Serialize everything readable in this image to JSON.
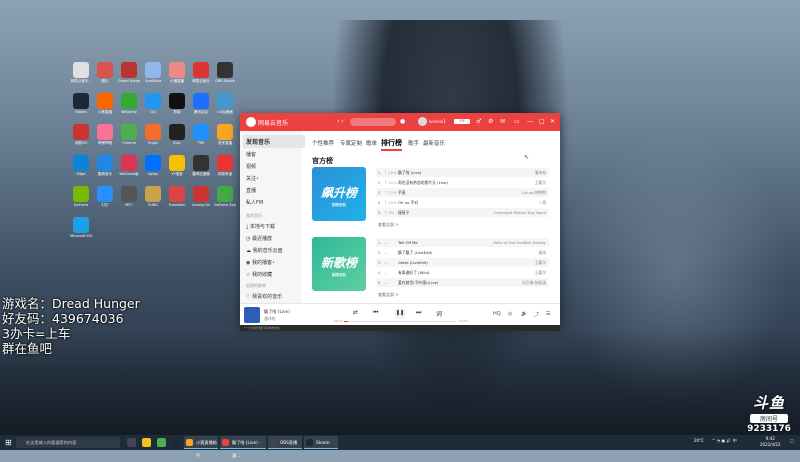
{
  "overlay": {
    "lines": [
      "游戏名：Dread Hunger",
      "好友码：439674036",
      "3办卡=上车",
      "群在鱼吧"
    ]
  },
  "douyu": {
    "logo": "斗鱼",
    "room_label": "房间号",
    "room_number": "9233176"
  },
  "desktop_icons": [
    {
      "label": "网易云音乐...",
      "color": "#e0e0e0"
    },
    {
      "label": "图片",
      "color": "#d9534f"
    },
    {
      "label": "Dread Hunger",
      "color": "#b33"
    },
    {
      "label": "OneDrive",
      "color": "#8fb7e8"
    },
    {
      "label": "小猪直播",
      "color": "#e88"
    },
    {
      "label": "网易云音乐",
      "color": "#d33"
    },
    {
      "label": "OBS Studio",
      "color": "#333"
    },
    {
      "label": "Steam",
      "color": "#1b2838"
    },
    {
      "label": "斗鱼直播",
      "color": "#f60"
    },
    {
      "label": "WeGame",
      "color": "#3a3"
    },
    {
      "label": "QQ",
      "color": "#2196f3"
    },
    {
      "label": "剪映",
      "color": "#111"
    },
    {
      "label": "腾讯会议",
      "color": "#1e6fff"
    },
    {
      "label": "UU加速器",
      "color": "#49c"
    },
    {
      "label": "网易UU",
      "color": "#c33"
    },
    {
      "label": "哔哩哔哩",
      "color": "#fb7299"
    },
    {
      "label": "Chrome",
      "color": "#4caf50"
    },
    {
      "label": "Origin",
      "color": "#f56c2d"
    },
    {
      "label": "Epic",
      "color": "#222"
    },
    {
      "label": "TIM",
      "color": "#1e90ff"
    },
    {
      "label": "虎牙直播",
      "color": "#f5a623"
    },
    {
      "label": "Edge",
      "color": "#0b84d8"
    },
    {
      "label": "酷狗音乐",
      "color": "#2086e8"
    },
    {
      "label": "WeGame版",
      "color": "#d35"
    },
    {
      "label": "Uplay",
      "color": "#0070ff"
    },
    {
      "label": "YY语音",
      "color": "#f5c200"
    },
    {
      "label": "雷神加速器",
      "color": "#333"
    },
    {
      "label": "网易有道",
      "color": "#e33"
    },
    {
      "label": "GeForce",
      "color": "#76b900"
    },
    {
      "label": "钉钉",
      "color": "#2a8eff"
    },
    {
      "label": "MFC",
      "color": "#555"
    },
    {
      "label": "PUBG",
      "color": "#c9a24a"
    },
    {
      "label": "Yuanshen",
      "color": "#d44"
    },
    {
      "label": "Among Us",
      "color": "#c33"
    },
    {
      "label": "GeForce Experience",
      "color": "#4a4"
    },
    {
      "label": "Microsoft Edge",
      "color": "#1da1e3"
    }
  ],
  "music_window": {
    "app_name": "网易云音乐",
    "username": "lvxinlin1",
    "vip": "VIP",
    "sidebar": {
      "items": [
        {
          "label": "发现音乐",
          "active": true
        },
        {
          "label": "播客"
        },
        {
          "label": "视频"
        },
        {
          "label": "关注",
          "dot": true
        },
        {
          "label": "直播"
        },
        {
          "label": "私人FM"
        }
      ],
      "section": "我的音乐",
      "my_items": [
        {
          "label": "本地与下载"
        },
        {
          "label": "最近播放"
        },
        {
          "label": "我的音乐云盘"
        },
        {
          "label": "我的播客",
          "dot": true
        },
        {
          "label": "我的收藏"
        }
      ],
      "created": "创建的歌单",
      "created_item": "我喜欢的音乐"
    },
    "tabs": [
      "个性推荐",
      "专属定制",
      "歌单",
      "排行榜",
      "歌手",
      "最新音乐"
    ],
    "active_tab": "排行榜",
    "section_title": "官方榜",
    "charts": [
      {
        "title": "飙升榜",
        "subtitle": "刚刚更新",
        "songs": [
          {
            "rank": "1",
            "tag": "↑ 16%",
            "name": "飘了啦 (Live)",
            "artist": "潘玮柏"
          },
          {
            "rank": "2",
            "tag": "↑ 12%",
            "name": "再也没有热恋的那片天 (Live)",
            "artist": "王嘉尔"
          },
          {
            "rank": "3",
            "tag": "↑ 11%",
            "name": "手表",
            "artist": "Lirium/何鸭鸭"
          },
          {
            "rank": "4",
            "tag": "↑ 10%",
            "name": "Oh no 不对",
            "artist": "二胡"
          },
          {
            "rank": "5",
            "tag": "↑ 9%",
            "name": "接接子",
            "artist": "Overnight Mutual Boy Band"
          }
        ],
        "see_all": "查看全部 >"
      },
      {
        "title": "新歌榜",
        "subtitle": "刚刚更新",
        "songs": [
          {
            "rank": "1",
            "tag": "—",
            "name": "Tell Off Me",
            "artist": "Hollo of the Goldfish Bloody"
          },
          {
            "rank": "2",
            "tag": "—",
            "name": "飘了飘了 (LiveEdit)",
            "artist": "潘玮"
          },
          {
            "rank": "3",
            "tag": "—",
            "name": "Gotta (LiveEdit)",
            "artist": "王嘉尔"
          },
          {
            "rank": "4",
            "tag": "—",
            "name": "有离谱好了 (Wild)",
            "artist": "王嘉尔"
          },
          {
            "rank": "5",
            "tag": "—",
            "name": "爱在前世(子叶版)(Live)",
            "artist": "古巨基/张韶涵"
          }
        ],
        "see_all": "查看全部 >"
      }
    ],
    "player": {
      "title": "飘了啦 (Live)",
      "artist": "潘玮柏",
      "current_time": "00:10",
      "total_time": "04:15",
      "progress": 0.04
    },
    "status_text": "一个大音乐旅行有你的合伙"
  },
  "taskbar": {
    "search_placeholder": "在这里输入你要搜索的内容",
    "apps": [
      {
        "label": "小狐直播助手",
        "color": "#f5a623"
      },
      {
        "label": "飘了啦 (Live) - 潘...",
        "color": "#ec4141"
      },
      {
        "label": "OBS直播",
        "color": "#444"
      },
      {
        "label": "Steam",
        "color": "#1b2838"
      }
    ],
    "temperature": "20°C",
    "time": "9:42",
    "date": "2022/4/22"
  }
}
